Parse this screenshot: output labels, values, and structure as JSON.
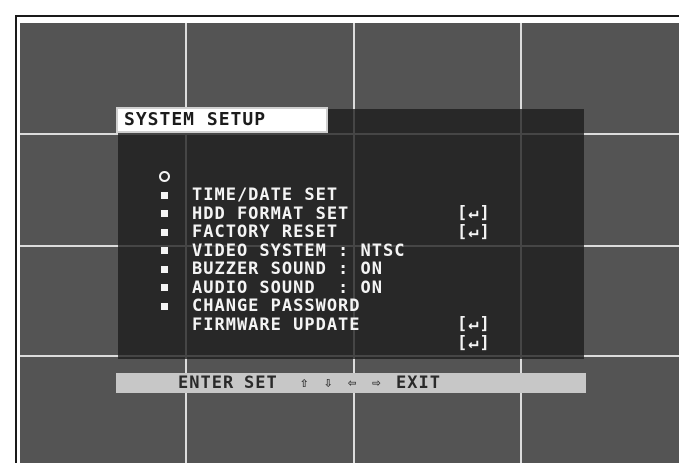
{
  "menu": {
    "title": "SYSTEM SETUP",
    "items": [
      {
        "label": "TIME/DATE SET",
        "enter": "[↵]",
        "bullet": "ring"
      },
      {
        "label": "HDD FORMAT SET",
        "enter": "[↵]",
        "bullet": "dot"
      },
      {
        "label": "FACTORY RESET",
        "enter": "",
        "bullet": "dot"
      },
      {
        "label": "VIDEO SYSTEM : NTSC",
        "enter": "",
        "bullet": "dot"
      },
      {
        "label": "BUZZER SOUND : ON",
        "enter": "",
        "bullet": "dot"
      },
      {
        "label": "AUDIO SOUND  : ON",
        "enter": "",
        "bullet": "dot"
      },
      {
        "label": "CHANGE PASSWORD",
        "enter": "[↵]",
        "bullet": "dot"
      },
      {
        "label": "FIRMWARE UPDATE",
        "enter": "[↵]",
        "bullet": "dot"
      }
    ]
  },
  "footer": {
    "enter": "ENTER",
    "set": "SET",
    "up": "⇧",
    "down": "⇩",
    "left": "⇦",
    "right": "⇨",
    "exit": "EXIT"
  },
  "colors": {
    "background": "#545454",
    "grid": "#dcdcdc",
    "panel": "#1c1c1c",
    "text": "#f4f4f4",
    "bar": "#c7c7c7"
  }
}
